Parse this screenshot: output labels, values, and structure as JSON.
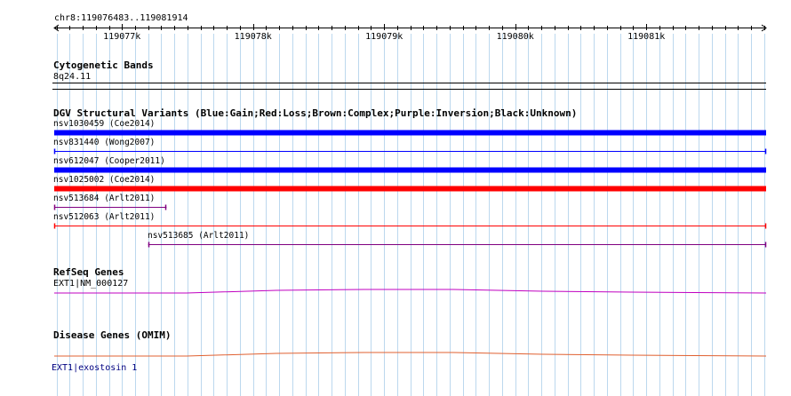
{
  "view": {
    "location": "chr8:119076483..119081914",
    "start": 119076483,
    "end": 119081914
  },
  "ruler": {
    "ticks": [
      {
        "pos": 119077000,
        "label": "119077k"
      },
      {
        "pos": 119078000,
        "label": "119078k"
      },
      {
        "pos": 119079000,
        "label": "119079k"
      },
      {
        "pos": 119080000,
        "label": "119080k"
      },
      {
        "pos": 119081000,
        "label": "119081k"
      }
    ],
    "minor_step": 100
  },
  "tracks": {
    "cytoband": {
      "title": "Cytogenetic Bands",
      "band": "8q24.11"
    },
    "dgv": {
      "title": "DGV Structural Variants (Blue:Gain;Red:Loss;Brown:Complex;Purple:Inversion;Black:Unknown)",
      "colors": {
        "gain": "#0000ff",
        "loss": "#ff0000",
        "inversion": "#800080"
      },
      "features": [
        {
          "label": "nsv1030459 (Coe2014)",
          "type": "gain",
          "start": 119076483,
          "end": 119081914,
          "bold": true
        },
        {
          "label": "nsv831440 (Wong2007)",
          "type": "gain",
          "start": 119076483,
          "end": 119081914,
          "bold": false
        },
        {
          "label": "nsv612047 (Cooper2011)",
          "type": "gain",
          "start": 119076483,
          "end": 119081914,
          "bold": true
        },
        {
          "label": "nsv1025002 (Coe2014)",
          "type": "loss",
          "start": 119076483,
          "end": 119081914,
          "bold": true
        },
        {
          "label": "nsv513684 (Arlt2011)",
          "type": "inversion",
          "start": 119076483,
          "end": 119077340,
          "bold": false
        },
        {
          "label": "nsv512063 (Arlt2011)",
          "type": "loss",
          "start": 119076483,
          "end": 119081914,
          "bold": false
        },
        {
          "label": "nsv513685 (Arlt2011)",
          "type": "inversion",
          "start": 119077200,
          "end": 119081914,
          "bold": false
        }
      ]
    },
    "refseq": {
      "title": "RefSeq Genes",
      "gene": "EXT1|NM_000127",
      "color": "#c000c0"
    },
    "omim": {
      "title": "Disease Genes (OMIM)",
      "gene": "EXT1|exostosin 1",
      "color": "#e06030",
      "label_color": "#000080"
    }
  }
}
